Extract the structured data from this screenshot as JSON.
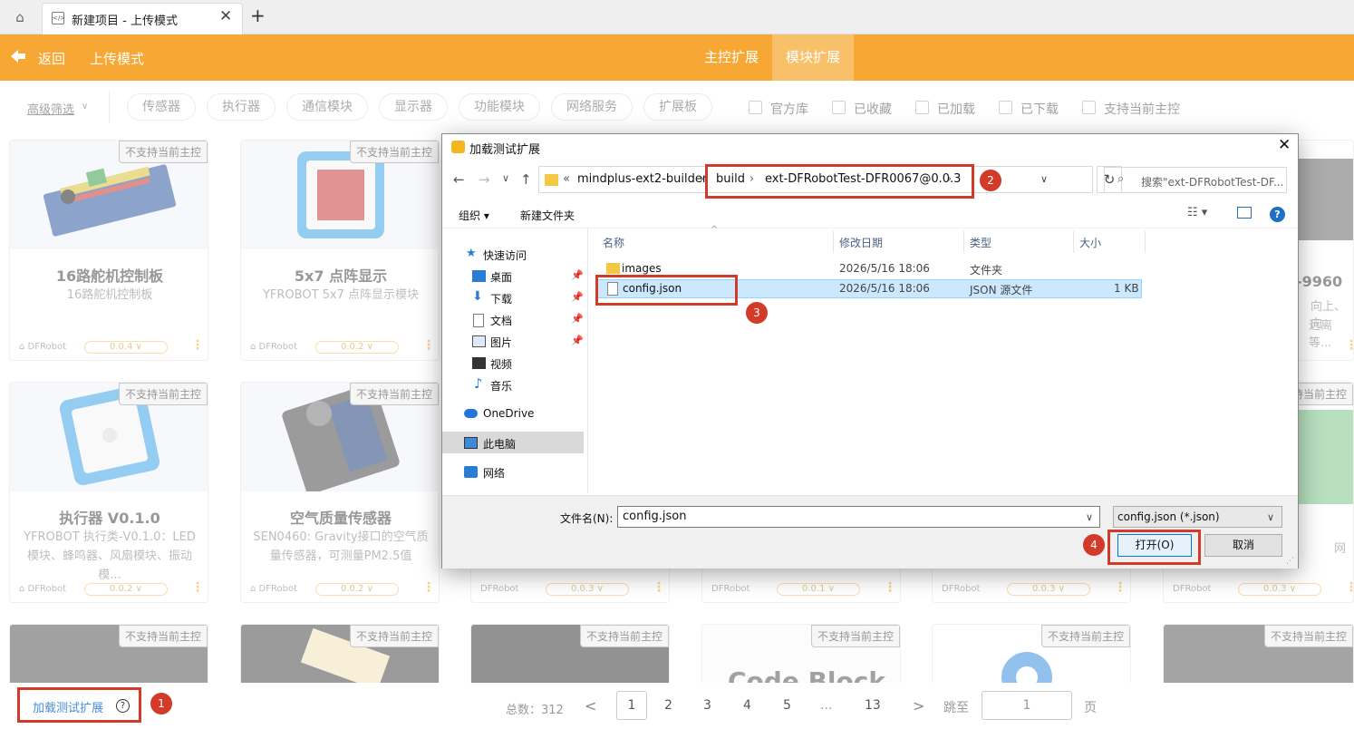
{
  "tabbar": {
    "tab_title": "新建项目 - 上传模式",
    "tab_close": "✕",
    "new_tab": "+"
  },
  "header": {
    "back": "返回",
    "mode": "上传模式",
    "tab_main": "主控扩展",
    "tab_module": "模块扩展"
  },
  "filters": {
    "advanced": "高级筛选",
    "chips": [
      "传感器",
      "执行器",
      "通信模块",
      "显示器",
      "功能模块",
      "网络服务",
      "扩展板"
    ],
    "checkboxes": [
      "官方库",
      "已收藏",
      "已加载",
      "已下载",
      "支持当前主控"
    ]
  },
  "cards": [
    {
      "badge": "不支持当前主控",
      "title": "16路舵机控制板",
      "desc": "16路舵机控制板",
      "brand": "DFRobot",
      "version": "0.0.4"
    },
    {
      "badge": "不支持当前主控",
      "title": "5x7 点阵显示",
      "desc": "YFROBOT 5x7 点阵显示模块",
      "brand": "DFRobot",
      "version": "0.0.2"
    },
    {
      "badge": "不支持当前主控",
      "title": "执行器 V0.1.0",
      "desc": "YFROBOT 执行类-V0.1.0：LED模块、蜂鸣器、风扇模块、振动模...",
      "brand": "DFRobot",
      "version": "0.0.2"
    },
    {
      "badge": "不支持当前主控",
      "title": "空气质量传感器",
      "desc": "SEN0460: Gravity接口的空气质量传感器，可测量PM2.5值",
      "brand": "DFRobot",
      "version": "0.0.2"
    }
  ],
  "partial_cards": {
    "badge": "不支持当前主控",
    "brand": "DFRobot",
    "row2_versions": [
      "0.0.3",
      "0.0.1",
      "0.0.3",
      "0.0.3"
    ],
    "right_title": "-9960",
    "right_desc1": "向上、向",
    "right_desc2": "远离等...",
    "right_desc3": "网",
    "code_block": "Code Block"
  },
  "bottom": {
    "load_test": "加载测试扩展",
    "help": "?",
    "total": "总数：312",
    "prev": "<",
    "pages": [
      "1",
      "2",
      "3",
      "4",
      "5",
      "...",
      "13"
    ],
    "next": ">",
    "jump": "跳至",
    "jump_value": "1",
    "page_unit": "页"
  },
  "dialog": {
    "title": "加载测试扩展",
    "address": {
      "prefix": "«",
      "root": "mindplus-ext2-builder",
      "build": "build",
      "folder": "ext-DFRobotTest-DFR0067@0.0.3"
    },
    "search_placeholder": "搜索\"ext-DFRobotTest-DF...",
    "toolbar": {
      "organize": "组织",
      "new_folder": "新建文件夹"
    },
    "nav": {
      "quick_access": "快速访问",
      "desktop": "桌面",
      "downloads": "下载",
      "documents": "文档",
      "pictures": "图片",
      "videos": "视频",
      "music": "音乐",
      "onedrive": "OneDrive",
      "this_pc": "此电脑",
      "network": "网络"
    },
    "columns": {
      "name": "名称",
      "modified": "修改日期",
      "type": "类型",
      "size": "大小"
    },
    "files": [
      {
        "name": "images",
        "modified": "2026/5/16 18:06",
        "type": "文件夹",
        "size": ""
      },
      {
        "name": "config.json",
        "modified": "2026/5/16 18:06",
        "type": "JSON 源文件",
        "size": "1 KB"
      }
    ],
    "filename_label": "文件名(N):",
    "filename_value": "config.json",
    "filetype": "config.json (*.json)",
    "open": "打开(O)",
    "cancel": "取消"
  },
  "annotations": [
    "1",
    "2",
    "3",
    "4"
  ],
  "colors": {
    "accent": "#f7a733",
    "annotation": "#d23a2a",
    "link": "#4a8fd6",
    "selection": "#cce8ff"
  }
}
